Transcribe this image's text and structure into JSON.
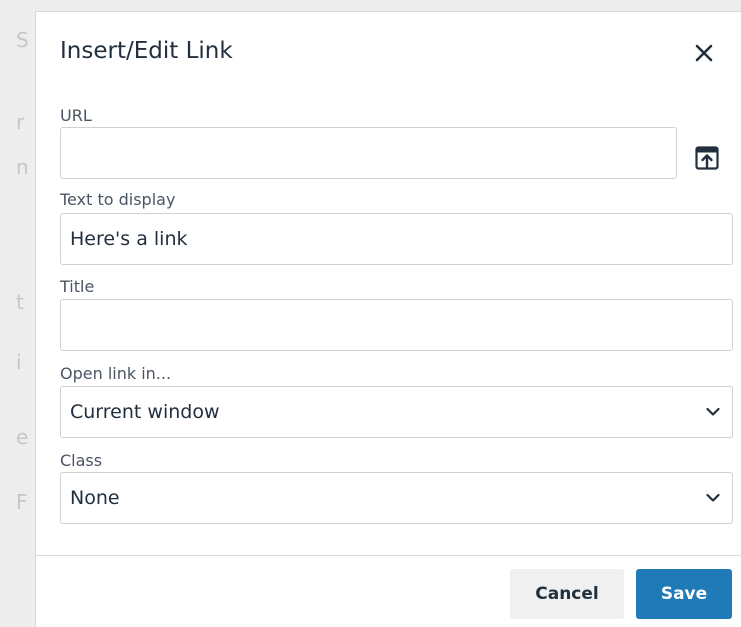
{
  "dialog": {
    "title": "Insert/Edit Link",
    "close_icon": "close-icon"
  },
  "fields": {
    "url": {
      "label": "URL",
      "value": "",
      "placeholder": ""
    },
    "browse_icon": "upload-browse-icon",
    "text_to_display": {
      "label": "Text to display",
      "value": "Here's a link"
    },
    "title": {
      "label": "Title",
      "value": ""
    },
    "open_link_in": {
      "label": "Open link in...",
      "selected": "Current window"
    },
    "class": {
      "label": "Class",
      "selected": "None"
    }
  },
  "footer": {
    "cancel_label": "Cancel",
    "save_label": "Save"
  },
  "colors": {
    "primary": "#207ab7",
    "text": "#222f3e",
    "border": "#cdd1d6"
  }
}
